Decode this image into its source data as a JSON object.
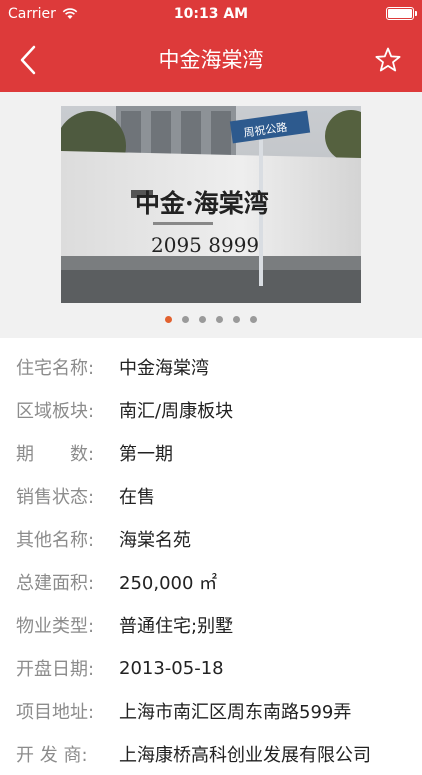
{
  "status_bar": {
    "carrier": "Carrier",
    "time": "10:13 AM"
  },
  "nav": {
    "title": "中金海棠湾"
  },
  "sign": {
    "name": "中金·海棠湾",
    "phone": "2095 8999",
    "street_sign": "周祝公路"
  },
  "gallery": {
    "active_index": 0,
    "total": 6
  },
  "info_rows": [
    {
      "label": "住宅名称:",
      "value": "中金海棠湾"
    },
    {
      "label": "区域板块:",
      "value": "南汇/周康板块"
    },
    {
      "label": "期　　数:",
      "value": "第一期"
    },
    {
      "label": "销售状态:",
      "value": "在售"
    },
    {
      "label": "其他名称:",
      "value": "海棠名苑"
    },
    {
      "label": "总建面积:",
      "value": "250,000 ㎡"
    },
    {
      "label": "物业类型:",
      "value": "普通住宅;别墅"
    },
    {
      "label": "开盘日期:",
      "value": "2013-05-18"
    },
    {
      "label": "项目地址:",
      "value": "上海市南汇区周东南路599弄"
    },
    {
      "label": "开 发 商:",
      "value": "上海康桥高科创业发展有限公司"
    }
  ],
  "colors": {
    "header": "#dd3a3a",
    "active_dot": "#e2612f"
  }
}
